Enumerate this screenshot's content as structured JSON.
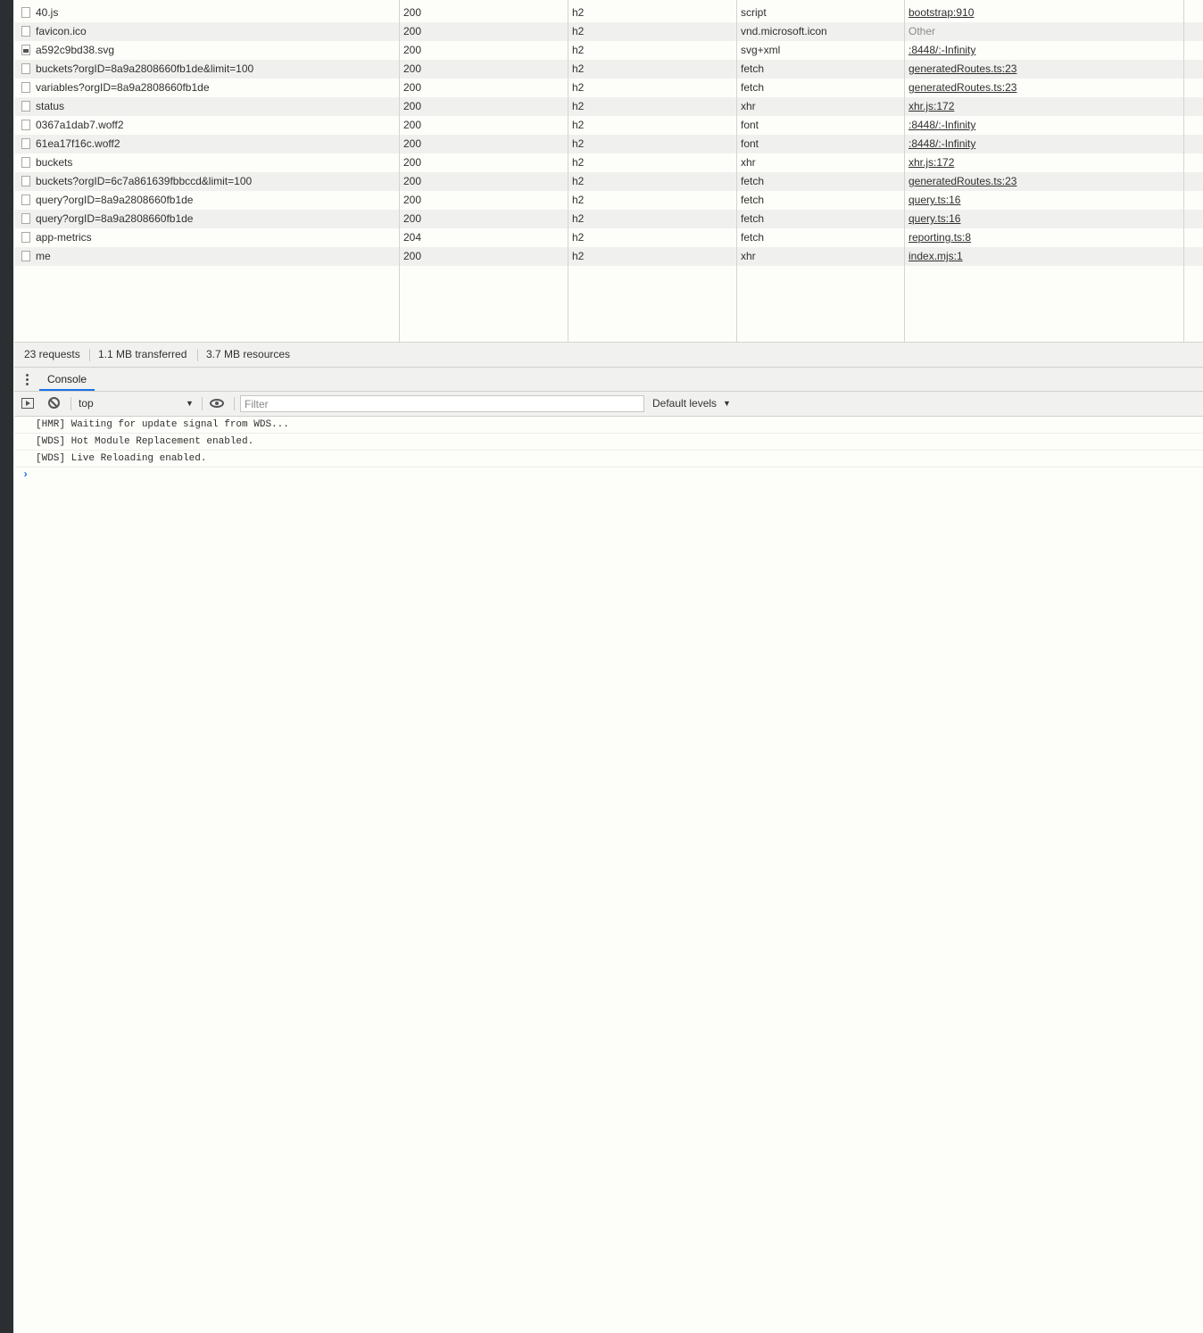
{
  "requests": [
    {
      "name": "40.js",
      "status": "200",
      "protocol": "h2",
      "type": "script",
      "initiator": "bootstrap:910",
      "icon": "file-icon",
      "initiator_link": true
    },
    {
      "name": "favicon.ico",
      "status": "200",
      "protocol": "h2",
      "type": "vnd.microsoft.icon",
      "initiator": "Other",
      "icon": "file-icon",
      "initiator_link": false
    },
    {
      "name": "a592c9bd38.svg",
      "status": "200",
      "protocol": "h2",
      "type": "svg+xml",
      "initiator": ":8448/:-Infinity",
      "icon": "image-icon",
      "initiator_link": true
    },
    {
      "name": "buckets?orgID=8a9a2808660fb1de&limit=100",
      "status": "200",
      "protocol": "h2",
      "type": "fetch",
      "initiator": "generatedRoutes.ts:23",
      "icon": "file-icon",
      "initiator_link": true
    },
    {
      "name": "variables?orgID=8a9a2808660fb1de",
      "status": "200",
      "protocol": "h2",
      "type": "fetch",
      "initiator": "generatedRoutes.ts:23",
      "icon": "file-icon",
      "initiator_link": true
    },
    {
      "name": "status",
      "status": "200",
      "protocol": "h2",
      "type": "xhr",
      "initiator": "xhr.js:172",
      "icon": "file-icon",
      "initiator_link": true
    },
    {
      "name": "0367a1dab7.woff2",
      "status": "200",
      "protocol": "h2",
      "type": "font",
      "initiator": ":8448/:-Infinity",
      "icon": "file-icon",
      "initiator_link": true
    },
    {
      "name": "61ea17f16c.woff2",
      "status": "200",
      "protocol": "h2",
      "type": "font",
      "initiator": ":8448/:-Infinity",
      "icon": "file-icon",
      "initiator_link": true
    },
    {
      "name": "buckets",
      "status": "200",
      "protocol": "h2",
      "type": "xhr",
      "initiator": "xhr.js:172",
      "icon": "file-icon",
      "initiator_link": true
    },
    {
      "name": "buckets?orgID=6c7a861639fbbccd&limit=100",
      "status": "200",
      "protocol": "h2",
      "type": "fetch",
      "initiator": "generatedRoutes.ts:23",
      "icon": "file-icon",
      "initiator_link": true
    },
    {
      "name": "query?orgID=8a9a2808660fb1de",
      "status": "200",
      "protocol": "h2",
      "type": "fetch",
      "initiator": "query.ts:16",
      "icon": "file-icon",
      "initiator_link": true
    },
    {
      "name": "query?orgID=8a9a2808660fb1de",
      "status": "200",
      "protocol": "h2",
      "type": "fetch",
      "initiator": "query.ts:16",
      "icon": "file-icon",
      "initiator_link": true
    },
    {
      "name": "app-metrics",
      "status": "204",
      "protocol": "h2",
      "type": "fetch",
      "initiator": "reporting.ts:8",
      "icon": "file-icon",
      "initiator_link": true
    },
    {
      "name": "me",
      "status": "200",
      "protocol": "h2",
      "type": "xhr",
      "initiator": "index.mjs:1",
      "icon": "file-icon",
      "initiator_link": true
    }
  ],
  "summary": {
    "requests": "23 requests",
    "transferred": "1.1 MB transferred",
    "resources": "3.7 MB resources"
  },
  "drawer": {
    "console_tab": "Console"
  },
  "console_toolbar": {
    "context": "top",
    "filter_placeholder": "Filter",
    "levels": "Default levels"
  },
  "console_logs": [
    "[HMR] Waiting for update signal from WDS...",
    "[WDS] Hot Module Replacement enabled.",
    "[WDS] Live Reloading enabled."
  ],
  "prompt_glyph": "›",
  "colors": {
    "accent": "#1a73e8",
    "row_alt": "#f0f1ef",
    "muted_text": "#8a8a8a"
  }
}
